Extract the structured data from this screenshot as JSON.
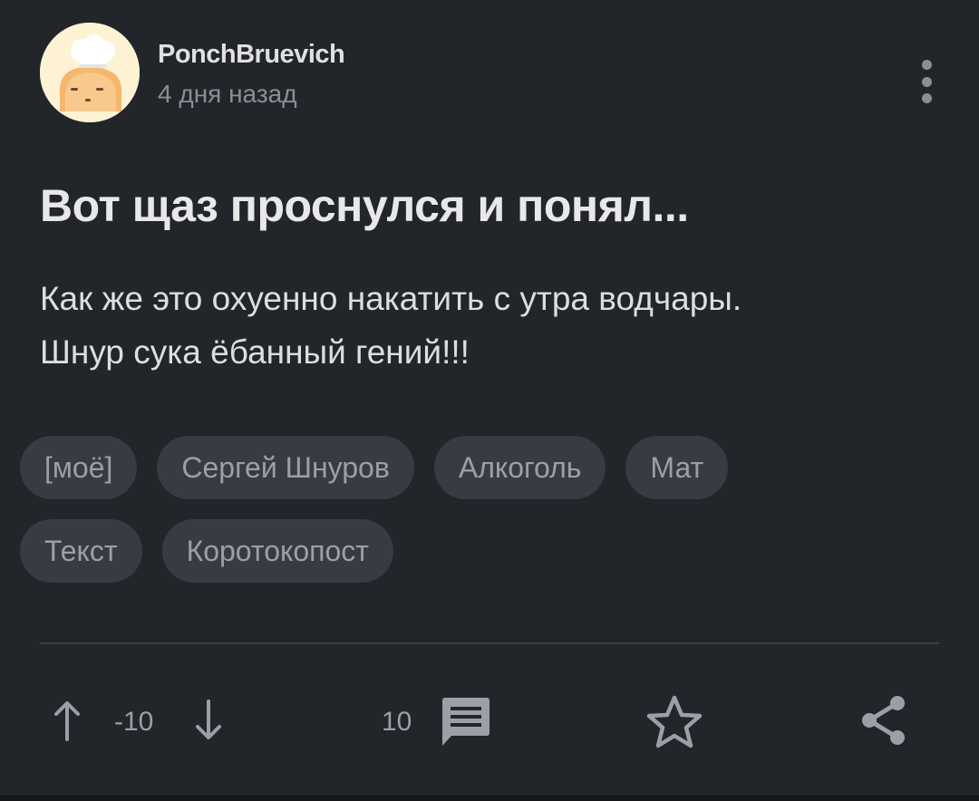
{
  "post": {
    "author": "PonchBruevich",
    "time": "4 дня назад",
    "title": "Вот щаз проснулся и понял...",
    "body_lines": [
      "Как же это охуенно накатить с утра водчары.",
      "Шнур сука ёбанный гений!!!"
    ]
  },
  "tags": {
    "row1": [
      "[моё]",
      "Сергей Шнуров",
      "Алкоголь",
      "Мат"
    ],
    "row2": [
      "Текст",
      "Коротокопост"
    ]
  },
  "actions": {
    "rating": "-10",
    "comments": "10"
  },
  "icons": {
    "avatar": "chef-toast-avatar",
    "more": "more-vertical-icon",
    "upvote": "arrow-up-icon",
    "downvote": "arrow-down-icon",
    "comments": "comment-icon",
    "save": "star-icon",
    "share": "share-icon"
  },
  "colors": {
    "background": "#22252a",
    "tag_background": "#383c42",
    "muted_text": "#9aa0a6"
  }
}
